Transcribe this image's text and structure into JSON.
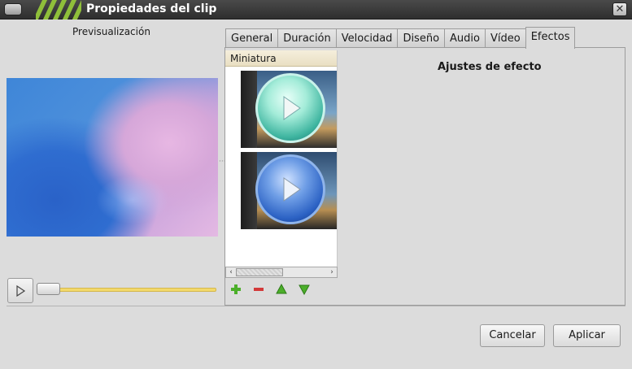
{
  "window": {
    "title": "Propiedades del clip",
    "close_icon": "close-icon"
  },
  "preview": {
    "label": "Previsualización",
    "position_fraction": 0.0
  },
  "tabs": [
    {
      "label": "General",
      "active": false
    },
    {
      "label": "Duración",
      "active": false
    },
    {
      "label": "Velocidad",
      "active": false
    },
    {
      "label": "Diseño",
      "active": false
    },
    {
      "label": "Audio",
      "active": false
    },
    {
      "label": "Vídeo",
      "active": false
    },
    {
      "label": "Efectos",
      "active": true
    }
  ],
  "effects": {
    "list_header": "Miniatura",
    "items": [
      {
        "icon": "play-icon",
        "color": "#3fb5a0"
      },
      {
        "icon": "play-icon",
        "color": "#2c62c4"
      }
    ],
    "settings_title": "Ajustes de efecto",
    "tools": [
      "add-icon",
      "remove-icon",
      "move-up-icon",
      "move-down-icon"
    ]
  },
  "buttons": {
    "cancel": "Cancelar",
    "apply": "Aplicar"
  },
  "colors": {
    "accent": "#8fbf3a",
    "slider": "#f3d96b",
    "titlebar": "#3a3a3a"
  }
}
